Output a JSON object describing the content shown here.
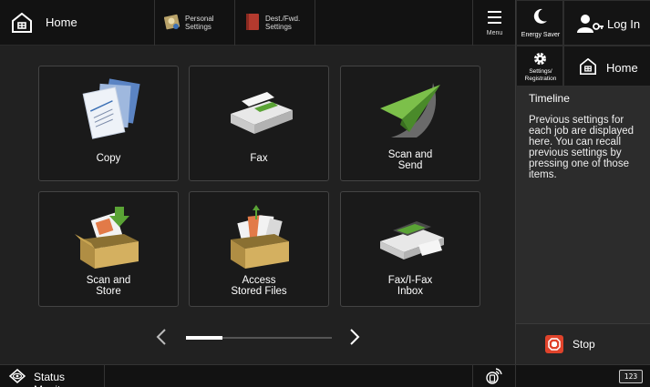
{
  "topbar": {
    "home_label": "Home",
    "shortcuts": [
      {
        "label_line1": "Personal",
        "label_line2": "Settings"
      },
      {
        "label_line1": "Dest./Fwd.",
        "label_line2": "Settings"
      }
    ],
    "menu_label": "Menu"
  },
  "side_panel": {
    "energy_saver_label": "Energy Saver",
    "login_label": "Log In",
    "settings_label_line1": "Settings/",
    "settings_label_line2": "Registration",
    "home_label": "Home",
    "timeline_title": "Timeline",
    "timeline_text": "Previous settings for each job are displayed here. You can recall previous settings by pressing one of those items.",
    "stop_label": "Stop"
  },
  "tiles": [
    {
      "line1": "Copy",
      "line2": "",
      "icon": "copy-icon"
    },
    {
      "line1": "Fax",
      "line2": "",
      "icon": "fax-icon"
    },
    {
      "line1": "Scan and",
      "line2": "Send",
      "icon": "scan-send-icon"
    },
    {
      "line1": "Scan and",
      "line2": "Store",
      "icon": "scan-store-icon"
    },
    {
      "line1": "Access",
      "line2": "Stored Files",
      "icon": "stored-files-icon"
    },
    {
      "line1": "Fax/I-Fax",
      "line2": "Inbox",
      "icon": "fax-inbox-icon"
    }
  ],
  "pager": {
    "page": 1,
    "pages": 4
  },
  "bottom": {
    "status_monitor_label": "Status Monitor",
    "keypad_label": "123"
  },
  "colors": {
    "accent_green": "#5aa335",
    "stop_red": "#e0432b",
    "box_tan": "#c8a451"
  }
}
